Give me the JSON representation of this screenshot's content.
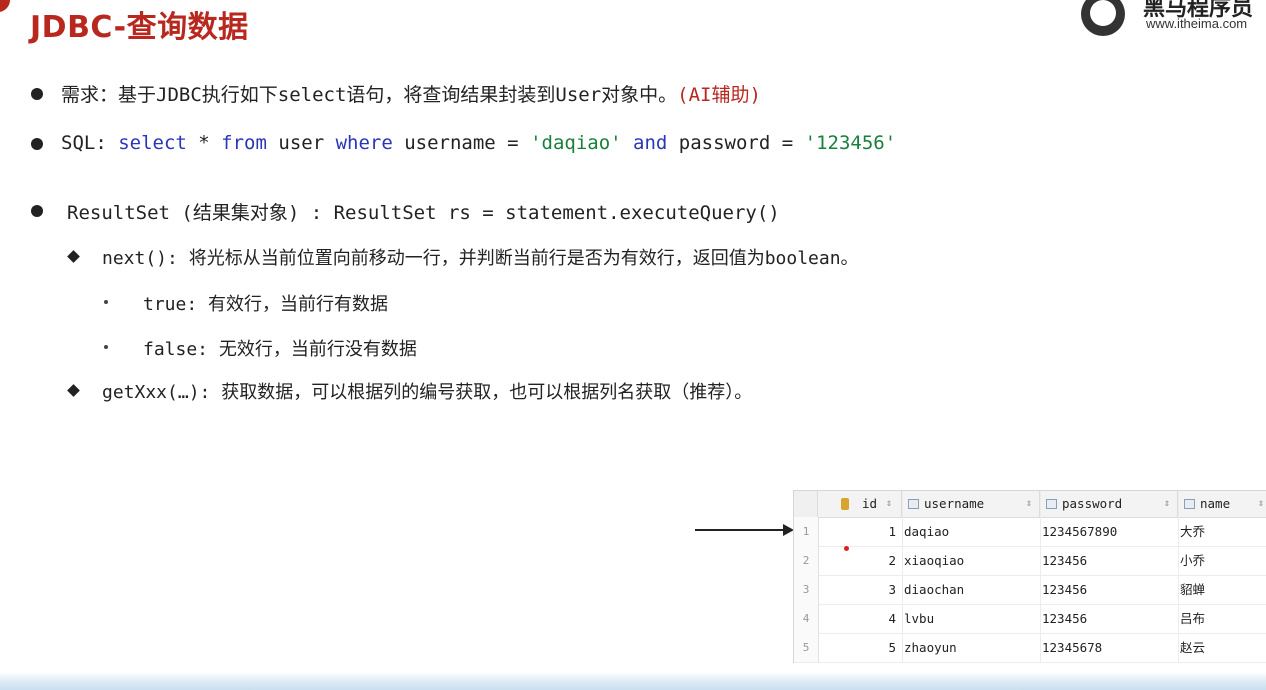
{
  "title": "JDBC-查询数据",
  "logo": {
    "cn": "黑马程序员",
    "url": "www.itheima.com"
  },
  "bullets": {
    "req": {
      "prefix": "需求：基于JDBC执行如下select语句，将查询结果封装到User对象中。",
      "suffix": "(AI辅助)"
    },
    "sql": {
      "label": "SQL: ",
      "t1": "select",
      "t2": " * ",
      "t3": "from",
      "t4": " user ",
      "t5": "where",
      "t6": " username = ",
      "t7": "'daqiao'",
      "t8": " ",
      "t9": "and",
      "t10": " password = ",
      "t11": "'123456'"
    },
    "resultset": "ResultSet (结果集对象) : ResultSet rs = statement.executeQuery()",
    "next": "next(): 将光标从当前位置向前移动一行，并判断当前行是否为有效行，返回值为boolean。",
    "true_item": "true: 有效行，当前行有数据",
    "false_item": "false: 无效行，当前行没有数据",
    "getxxx": "getXxx(…): 获取数据，可以根据列的编号获取，也可以根据列名获取（推荐）。"
  },
  "table": {
    "columns": [
      "id",
      "username",
      "password",
      "name"
    ],
    "rows": [
      {
        "num": "1",
        "id": "1",
        "username": "daqiao",
        "password": "1234567890",
        "name": "大乔"
      },
      {
        "num": "2",
        "id": "2",
        "username": "xiaoqiao",
        "password": "123456",
        "name": "小乔"
      },
      {
        "num": "3",
        "id": "3",
        "username": "diaochan",
        "password": "123456",
        "name": "貂蝉"
      },
      {
        "num": "4",
        "id": "4",
        "username": "lvbu",
        "password": "123456",
        "name": "吕布"
      },
      {
        "num": "5",
        "id": "5",
        "username": "zhaoyun",
        "password": "12345678",
        "name": "赵云"
      }
    ]
  },
  "colors": {
    "title": "#b8281e",
    "keyword": "#2a35b8",
    "string": "#1a7f3c"
  }
}
